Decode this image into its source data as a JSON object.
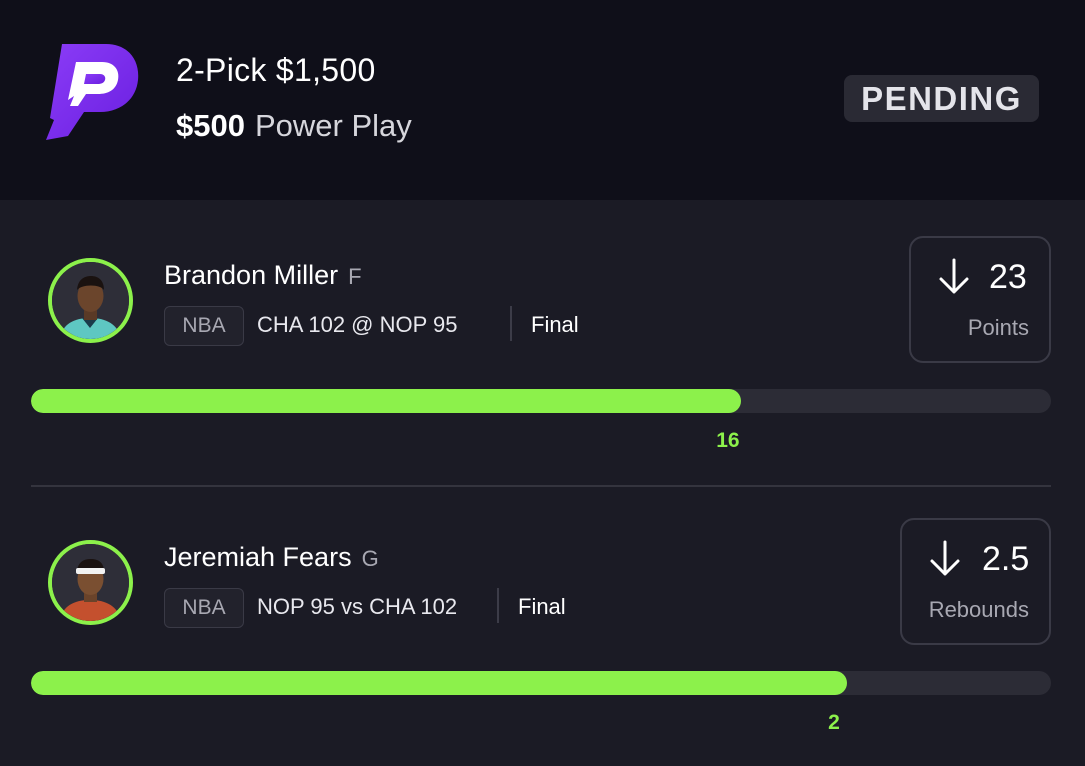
{
  "header": {
    "title": "2-Pick $1,500",
    "entry_amount": "$500",
    "play_type": "Power Play",
    "status": "PENDING"
  },
  "picks": [
    {
      "player": "Brandon Miller",
      "position": "F",
      "league": "NBA",
      "matchup": "CHA 102 @ NOP 95",
      "game_status": "Final",
      "direction_icon": "arrow-down-icon",
      "line": "23",
      "stat_type": "Points",
      "current": "16",
      "progress_fraction": 0.696
    },
    {
      "player": "Jeremiah Fears",
      "position": "G",
      "league": "NBA",
      "matchup": "NOP 95 vs CHA 102",
      "game_status": "Final",
      "direction_icon": "arrow-down-icon",
      "line": "2.5",
      "stat_type": "Rebounds",
      "current": "2",
      "progress_fraction": 0.8
    }
  ],
  "colors": {
    "accent_green": "#8cf14b",
    "brand_purple": "#7a2bf0",
    "background": "#1b1b25",
    "header_background": "#0f0f19"
  }
}
